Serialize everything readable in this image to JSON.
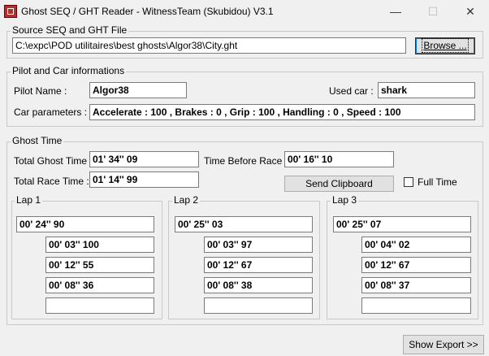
{
  "window": {
    "title": "Ghost SEQ / GHT Reader - WitnessTeam (Skubidou) V3.1",
    "minimize": "—",
    "maximize": "☐",
    "close": "✕"
  },
  "source": {
    "legend": "Source SEQ and GHT File",
    "path": "C:\\expc\\POD utilitaires\\best ghosts\\Algor38\\City.ght",
    "browse": "Browse ..."
  },
  "pilot": {
    "legend": "Pilot and Car informations",
    "name_label": "Pilot Name :",
    "name": "Algor38",
    "car_label": "Used car :",
    "car": "shark",
    "params_label": "Car parameters :",
    "params": "Accelerate : 100 , Brakes : 0 , Grip : 100 , Handling : 0 , Speed : 100"
  },
  "ghost": {
    "legend": "Ghost Time",
    "total_ghost_label": "Total Ghost Time :",
    "total_ghost": "01' 34'' 09",
    "before_race_label": "Time Before Race :",
    "before_race": "00' 16'' 10",
    "total_race_label": "Total Race Time :",
    "total_race": "01' 14'' 99",
    "send_clipboard": "Send Clipboard",
    "full_time_label": "Full Time",
    "laps": [
      {
        "label": "Lap 1",
        "total": "00' 24'' 90",
        "splits": [
          "00' 03'' 100",
          "00' 12'' 55",
          "00' 08'' 36",
          ""
        ]
      },
      {
        "label": "Lap 2",
        "total": "00' 25'' 03",
        "splits": [
          "00' 03'' 97",
          "00' 12'' 67",
          "00' 08'' 38",
          ""
        ]
      },
      {
        "label": "Lap 3",
        "total": "00' 25'' 07",
        "splits": [
          "00' 04'' 02",
          "00' 12'' 67",
          "00' 08'' 37",
          ""
        ]
      }
    ]
  },
  "show_export": "Show Export >>"
}
